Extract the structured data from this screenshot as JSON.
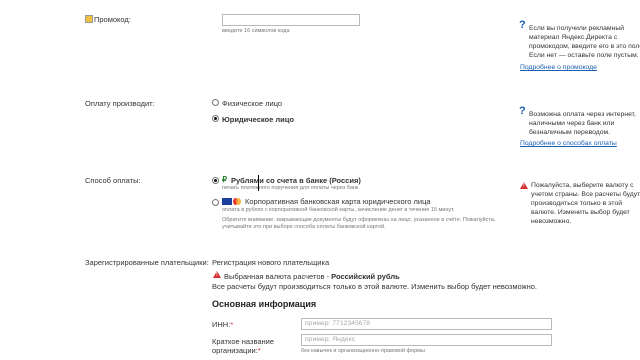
{
  "promo": {
    "label": "Промокод:",
    "hint": "введите 16 символов кода",
    "help_text": "Если вы получили рекламный материал Яндекс.Директа с промокодом, введите его в это поле. Если нет — оставьте поле пустым.",
    "help_link": "Подробнее о промокоде"
  },
  "payer": {
    "label": "Оплату производит:",
    "option_individual": "Физическое лицо",
    "option_legal": "Юридическое лицо",
    "selected": "legal",
    "help_text": "Возможна оплата через интернет, наличными через банк или безналичным переводом.",
    "help_link": "Подробнее о способах оплаты"
  },
  "payment_method": {
    "label": "Способ оплаты:",
    "option_bank_title": "Рублями со счета в банке (Россия)",
    "option_bank_desc": "печать платежного поручения для оплаты через банк",
    "option_card_title": "Корпоративная банковская карта юридического лица",
    "option_card_desc": "оплата в рублях с корпоративной банковской карты, зачисление денег в течение 15 минут.",
    "option_card_note": "Обратите внимание: закрывающие документы будут оформлены на лицо, указанное в счёте. Пожалуйста, учитывайте это при выборе способа оплаты банковской картой.",
    "selected": "bank",
    "warning_text": "Пожалуйста, выберите валюту с учетом страны. Все расчеты будут производиться только в этой валюте. Изменить выбор будет невозможно."
  },
  "registered_payers": {
    "label": "Зарегистрированные плательщики:",
    "value": "Регистрация нового плательщика",
    "currency_prefix": "Выбранная валюта расчетов - ",
    "currency_value": "Российский рубль",
    "currency_note": "Все расчеты будут производиться только в этой валюте. Изменить выбор будет невозможно."
  },
  "main_info": {
    "heading": "Основная информация",
    "inn_label": "ИНН:",
    "inn_placeholder": "пример: 7712345678",
    "org_label_1": "Краткое название",
    "org_label_2": "организации:",
    "org_placeholder": "пример: Яндекс",
    "org_hint": "без кавычек и организационно-правовой формы"
  },
  "colors": {
    "link": "#1a5fb4",
    "required": "#d32f2f",
    "warning": "#d32f2f"
  }
}
